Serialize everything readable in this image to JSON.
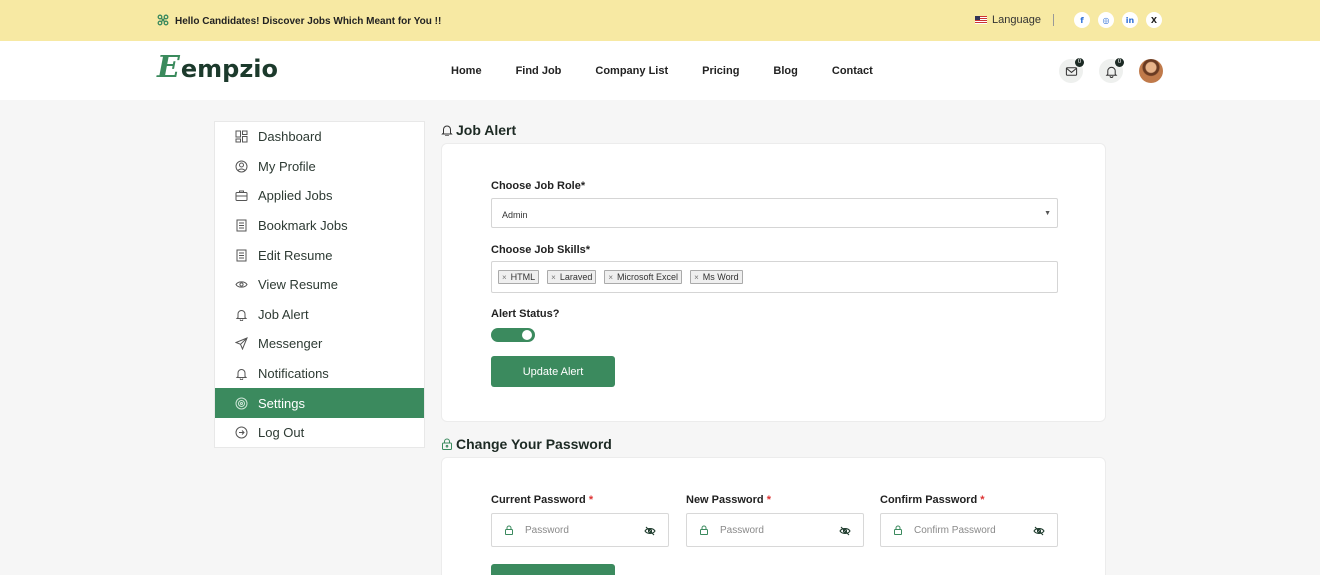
{
  "topbar": {
    "promo": "Hello Candidates! Discover Jobs Which Meant for You !!",
    "language": "Language",
    "social": [
      "f",
      "◎",
      "in",
      "X"
    ]
  },
  "header": {
    "logo_letter": "E",
    "logo_text": "empzio",
    "nav": [
      "Home",
      "Find Job",
      "Company List",
      "Pricing",
      "Blog",
      "Contact"
    ],
    "mail_count": "0",
    "notif_count": "0"
  },
  "sidebar": {
    "items": [
      {
        "label": "Dashboard",
        "icon": "dashboard-icon"
      },
      {
        "label": "My Profile",
        "icon": "profile-icon"
      },
      {
        "label": "Applied Jobs",
        "icon": "briefcase-icon"
      },
      {
        "label": "Bookmark Jobs",
        "icon": "bookmark-icon"
      },
      {
        "label": "Edit Resume",
        "icon": "document-icon"
      },
      {
        "label": "View Resume",
        "icon": "eye-icon"
      },
      {
        "label": "Job Alert",
        "icon": "bell-icon"
      },
      {
        "label": "Messenger",
        "icon": "send-icon"
      },
      {
        "label": "Notifications",
        "icon": "bell-icon"
      },
      {
        "label": "Settings",
        "icon": "settings-icon",
        "active": true
      },
      {
        "label": "Log Out",
        "icon": "logout-icon"
      }
    ]
  },
  "job_alert": {
    "title": "Job Alert",
    "role_label": "Choose Job Role*",
    "role_value": "Admin",
    "skills_label": "Choose Job Skills*",
    "skills": [
      "HTML",
      "Laraved",
      "Microsoft Excel",
      "Ms Word"
    ],
    "status_label": "Alert Status?",
    "status_on": true,
    "update_button": "Update Alert"
  },
  "password": {
    "title": "Change Your Password",
    "current_label": "Current Password",
    "new_label": "New Password",
    "confirm_label": "Confirm Password",
    "required_mark": "*",
    "current_placeholder": "Password",
    "new_placeholder": "Password",
    "confirm_placeholder": "Confirm Password"
  },
  "colors": {
    "brand_green": "#3b8a5e",
    "topbar_yellow": "#f7e9a3"
  }
}
